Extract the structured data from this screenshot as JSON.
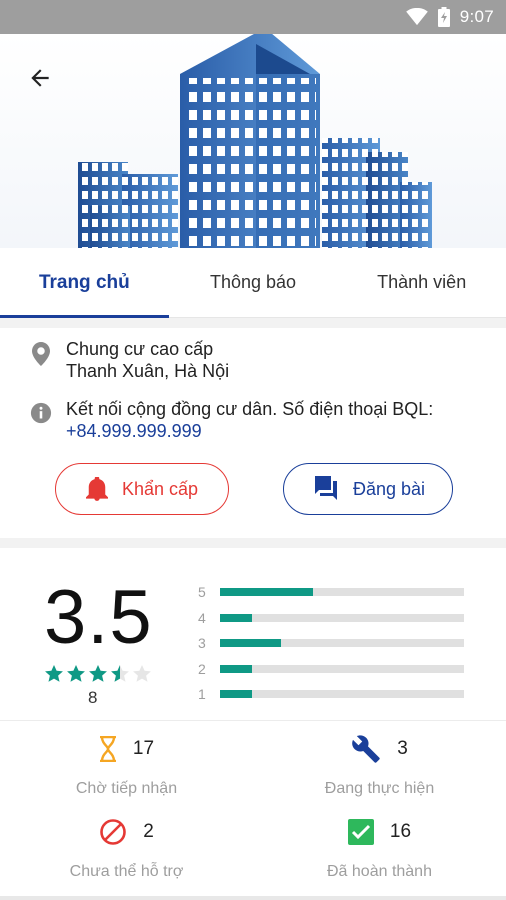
{
  "status_bar": {
    "time": "9:07"
  },
  "header": {
    "back_icon": "arrow-left-icon",
    "illustration": "buildings"
  },
  "tabs": [
    {
      "label": "Trang chủ",
      "active": true
    },
    {
      "label": "Thông báo",
      "active": false
    },
    {
      "label": "Thành viên",
      "active": false
    }
  ],
  "info": {
    "address_line1": "Chung cư cao cấp",
    "address_line2": "Thanh Xuân, Hà Nội",
    "description": "Kết nối cộng đồng cư dân. Số điện thoại BQL:",
    "phone": "+84.999.999.999"
  },
  "buttons": {
    "emergency": "Khẩn cấp",
    "post": "Đăng bài"
  },
  "rating": {
    "average": "3.5",
    "count": "8",
    "stars": 3.5,
    "distribution": [
      {
        "label": "5",
        "fraction": 0.38
      },
      {
        "label": "4",
        "fraction": 0.13
      },
      {
        "label": "3",
        "fraction": 0.25
      },
      {
        "label": "2",
        "fraction": 0.13
      },
      {
        "label": "1",
        "fraction": 0.13
      }
    ]
  },
  "stats": [
    {
      "value": "17",
      "label": "Chờ tiếp nhận",
      "icon": "hourglass-icon"
    },
    {
      "value": "3",
      "label": "Đang thực hiện",
      "icon": "wrench-icon"
    },
    {
      "value": "2",
      "label": "Chưa thể hỗ trợ",
      "icon": "prohibited-icon"
    },
    {
      "value": "16",
      "label": "Đã hoàn thành",
      "icon": "check-box-icon"
    }
  ],
  "colors": {
    "primary": "#1a3f9a",
    "emergency": "#e53935",
    "rating_bar": "#0f9985",
    "star": "#0f9985"
  }
}
